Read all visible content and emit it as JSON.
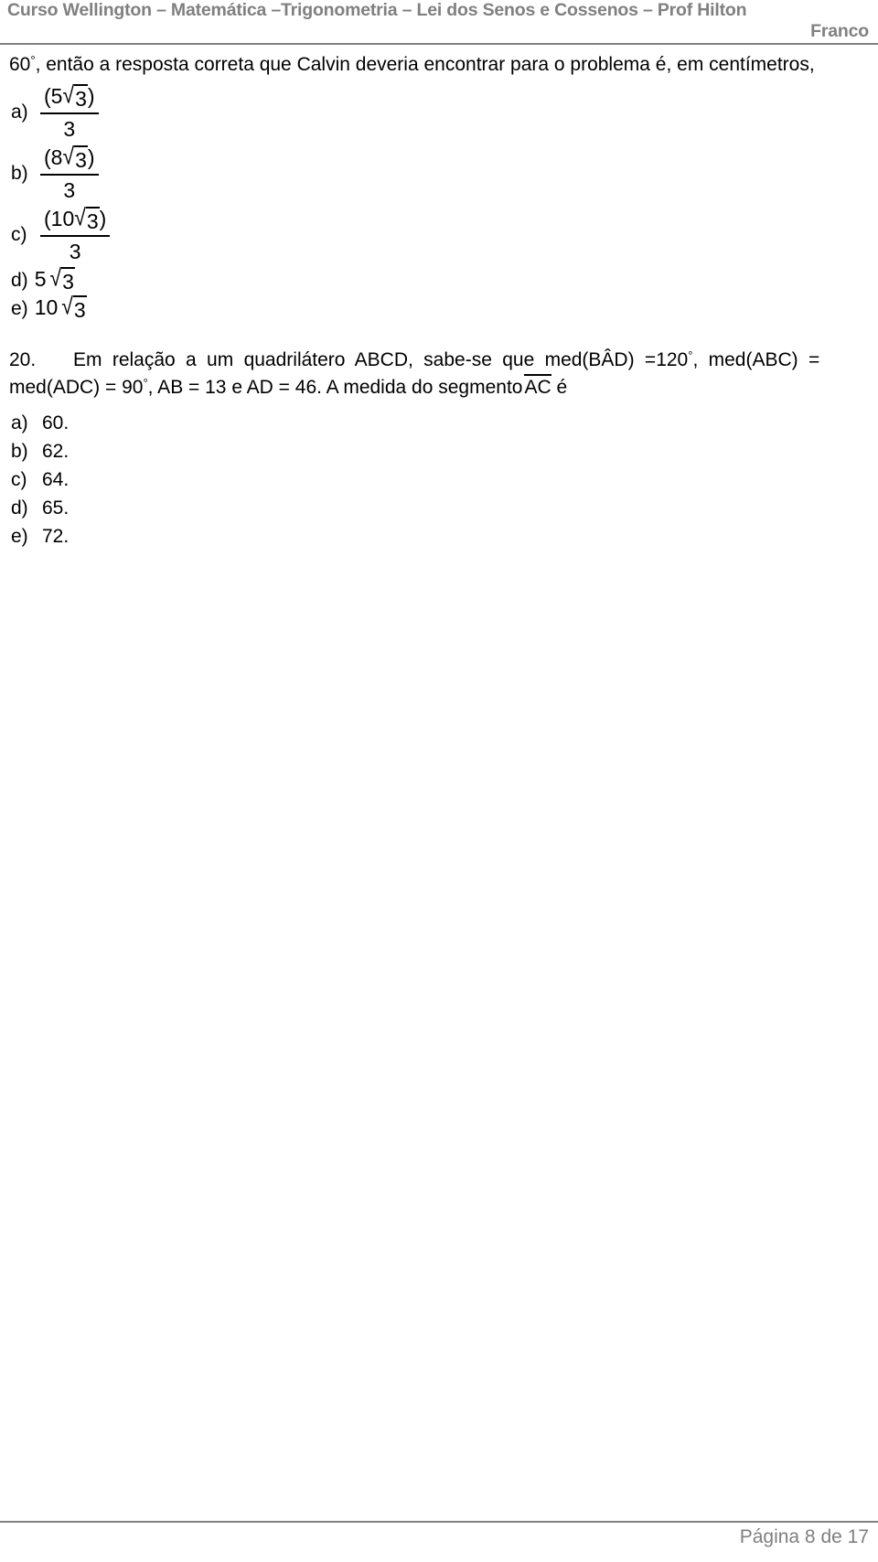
{
  "header": {
    "line1": "Curso Wellington – Matemática –Trigonometria – Lei dos Senos e Cossenos – Prof Hilton",
    "line2": "Franco",
    "color": "#808080"
  },
  "question_19_tail": {
    "lead_value": "60",
    "degree_symbol": "°",
    "text": ", então a resposta correta que Calvin deveria encontrar para o problema é, em centímetros,",
    "alternatives": [
      {
        "letter": "a)",
        "kind": "fraction",
        "numerator_prefix": "(5",
        "radical": "3",
        "numerator_suffix": ")",
        "denominator": "3"
      },
      {
        "letter": "b)",
        "kind": "fraction",
        "numerator_prefix": "(8",
        "radical": "3",
        "numerator_suffix": ")",
        "denominator": "3"
      },
      {
        "letter": "c)",
        "kind": "fraction",
        "numerator_prefix": "(10",
        "radical": "3",
        "numerator_suffix": ")",
        "denominator": "3"
      },
      {
        "letter": "d)",
        "kind": "radical",
        "coefficient": "5",
        "radical": "3"
      },
      {
        "letter": "e)",
        "kind": "radical",
        "coefficient": "10",
        "radical": "3"
      }
    ]
  },
  "question_20": {
    "number": "20.",
    "line1": "Em relação a um quadrilátero ABCD, sabe-se que med(BÂD) =120",
    "line1_degree": "°",
    "line1_end": ", med(ABC) =",
    "line2_a": "med(ADC) = 90",
    "line2_degree": "°",
    "line2_b": ", AB = 13 e AD = 46. A medida do segmento",
    "segment": "AC",
    "line2_c": "é",
    "alternatives": [
      {
        "letter": "a)",
        "value": "60."
      },
      {
        "letter": "b)",
        "value": "62."
      },
      {
        "letter": "c)",
        "value": "64."
      },
      {
        "letter": "d)",
        "value": "65."
      },
      {
        "letter": "e)",
        "value": "72."
      }
    ]
  },
  "footer": {
    "page_label": "Página 8 de 17",
    "color": "#7f7f7f"
  }
}
